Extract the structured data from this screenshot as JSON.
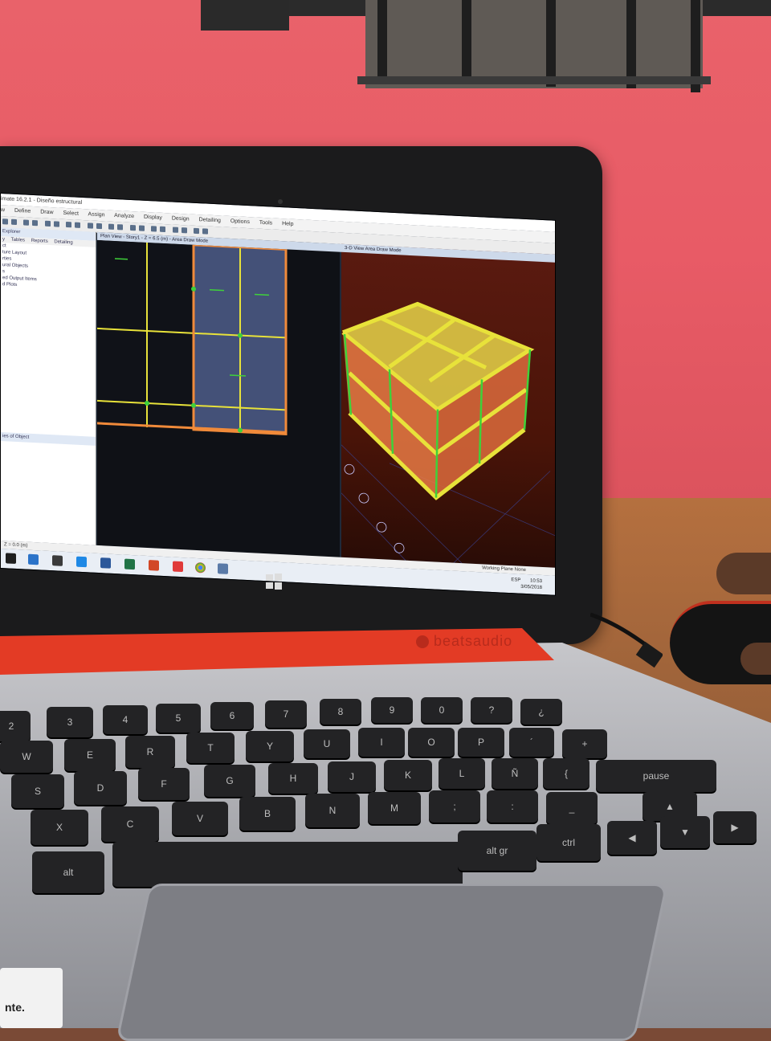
{
  "window": {
    "title": "imate 16.2.1 - Diseño estructural",
    "menus": [
      "w",
      "Define",
      "Draw",
      "Select",
      "Assign",
      "Analyze",
      "Display",
      "Design",
      "Detailing",
      "Options",
      "Tools",
      "Help"
    ]
  },
  "explorer": {
    "title": "Explorer",
    "tabs": [
      "y",
      "Tables",
      "Reports",
      "Detailing"
    ],
    "items": [
      "ct",
      "ture Layout",
      "rties",
      "ural Objects",
      "s",
      "ed Output Items",
      "d Plots"
    ],
    "lower_title": "ies of Object"
  },
  "plan_view": {
    "tab": "Plan View - Story1 - Z = 6.5 (m) - Area Draw Mode"
  },
  "view_3d": {
    "tab": "3-D View  Area Draw Mode"
  },
  "status_bar": {
    "coords": "Z = 0.0 (m)",
    "working_plane": "Working Plane  None"
  },
  "taskbar": {
    "time": "10:53",
    "date": "3/05/2018",
    "lang": "ESP"
  },
  "laptop": {
    "brand": "beatsaudio"
  },
  "keyboard": {
    "row1": [
      "2",
      "3",
      "4",
      "5",
      "6",
      "7",
      "8",
      "9",
      "0",
      "?",
      "¿"
    ],
    "row2": [
      "W",
      "E",
      "R",
      "T",
      "Y",
      "U",
      "I",
      "O",
      "P",
      "´",
      "+"
    ],
    "row3": [
      "S",
      "D",
      "F",
      "G",
      "H",
      "J",
      "K",
      "L",
      "Ñ",
      "{",
      "}"
    ],
    "row4": [
      "X",
      "C",
      "V",
      "B",
      "N",
      "M",
      ";",
      ":",
      "_"
    ],
    "row5": [
      "alt",
      "alt gr",
      "ctrl"
    ],
    "pause": "pause"
  },
  "sticker": {
    "text": "nte."
  },
  "colors": {
    "wall": "#e85b66",
    "laptop_red": "#e33b25",
    "frame_yellow": "#e8e23a",
    "frame_orange": "#f08a3a",
    "column_green": "#3fd13a"
  }
}
